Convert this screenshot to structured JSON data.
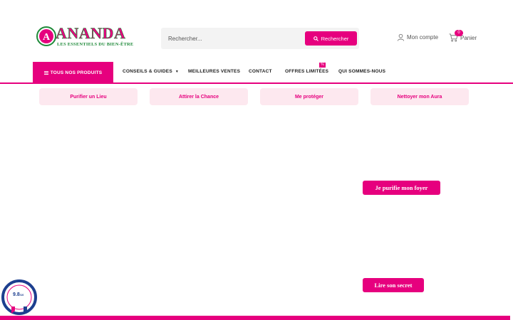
{
  "logo": {
    "name": "ANANDA",
    "tagline": "LES ESSENTIELS DU BIEN-ÊTRE"
  },
  "search": {
    "placeholder": "Rechercher...",
    "button_label": "Rechercher"
  },
  "header": {
    "account_label": "Mon compte",
    "cart_label": "Panier",
    "cart_count": "0"
  },
  "nav": {
    "all_products": "TOUS NOS PRODUITS",
    "items": [
      {
        "label": "CONSEILS & GUIDES"
      },
      {
        "label": "MEILLEURES VENTES"
      },
      {
        "label": "CONTACT"
      },
      {
        "label": "OFFRES LIMITÉES"
      },
      {
        "label": "QUI SOMMES-NOUS"
      }
    ],
    "promo_badge": "%"
  },
  "categories": [
    {
      "label": "Purifier un Lieu"
    },
    {
      "label": "Attirer la Chance"
    },
    {
      "label": "Me protéger"
    },
    {
      "label": "Nettoyer mon Aura"
    }
  ],
  "cta": {
    "purify_home": "Je purifie mon foyer",
    "read_secret": "Lire son secret"
  },
  "review_seal": {
    "score": "9.8",
    "scale": "/10"
  },
  "colors": {
    "accent": "#e6007e",
    "pill_bg": "#fde8ef",
    "logo_green": "#1f8a3a",
    "seal_blue": "#1d3f8f"
  }
}
